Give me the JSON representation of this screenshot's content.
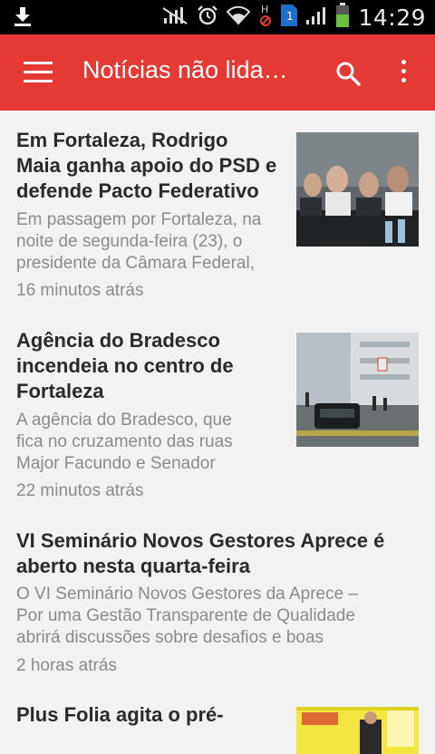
{
  "status_bar": {
    "time": "14:29",
    "notification_icons": [
      "download-icon"
    ],
    "system_icons": [
      "mute-icon",
      "alarm-icon",
      "wifi-icon",
      "no-signal-h-icon",
      "sim-1-icon",
      "signal-icon",
      "battery-icon"
    ]
  },
  "toolbar": {
    "title": "Notícias não lida…",
    "color": "#e53935"
  },
  "articles": [
    {
      "title_lines": [
        "Em Fortaleza, Rodrigo",
        "Maia ganha apoio do PSD e",
        "defende Pacto Federativo"
      ],
      "excerpt_lines": [
        "Em passagem por Fortaleza, na",
        "noite de segunda-feira (23), o",
        "presidente da Câmara Federal,"
      ],
      "time": "16 minutos atrás",
      "has_image": true
    },
    {
      "title_lines": [
        "Agência do Bradesco",
        "incendeia no centro de",
        "Fortaleza"
      ],
      "excerpt_lines": [
        "A agência do Bradesco, que",
        "fica no cruzamento das ruas",
        "Major Facundo e Senador"
      ],
      "time": "22 minutos atrás",
      "has_image": true
    },
    {
      "title_lines": [
        "VI Seminário Novos Gestores Aprece é",
        "aberto nesta quarta-feira"
      ],
      "excerpt_lines": [
        "O VI Seminário Novos Gestores da Aprece –",
        "Por uma Gestão Transparente de Qualidade",
        "abrirá discussões sobre desafios e boas"
      ],
      "time": "2 horas atrás",
      "has_image": false
    },
    {
      "title_lines": [
        "Plus Folia agita o pré-"
      ],
      "excerpt_lines": [],
      "time": "",
      "has_image": true
    }
  ]
}
